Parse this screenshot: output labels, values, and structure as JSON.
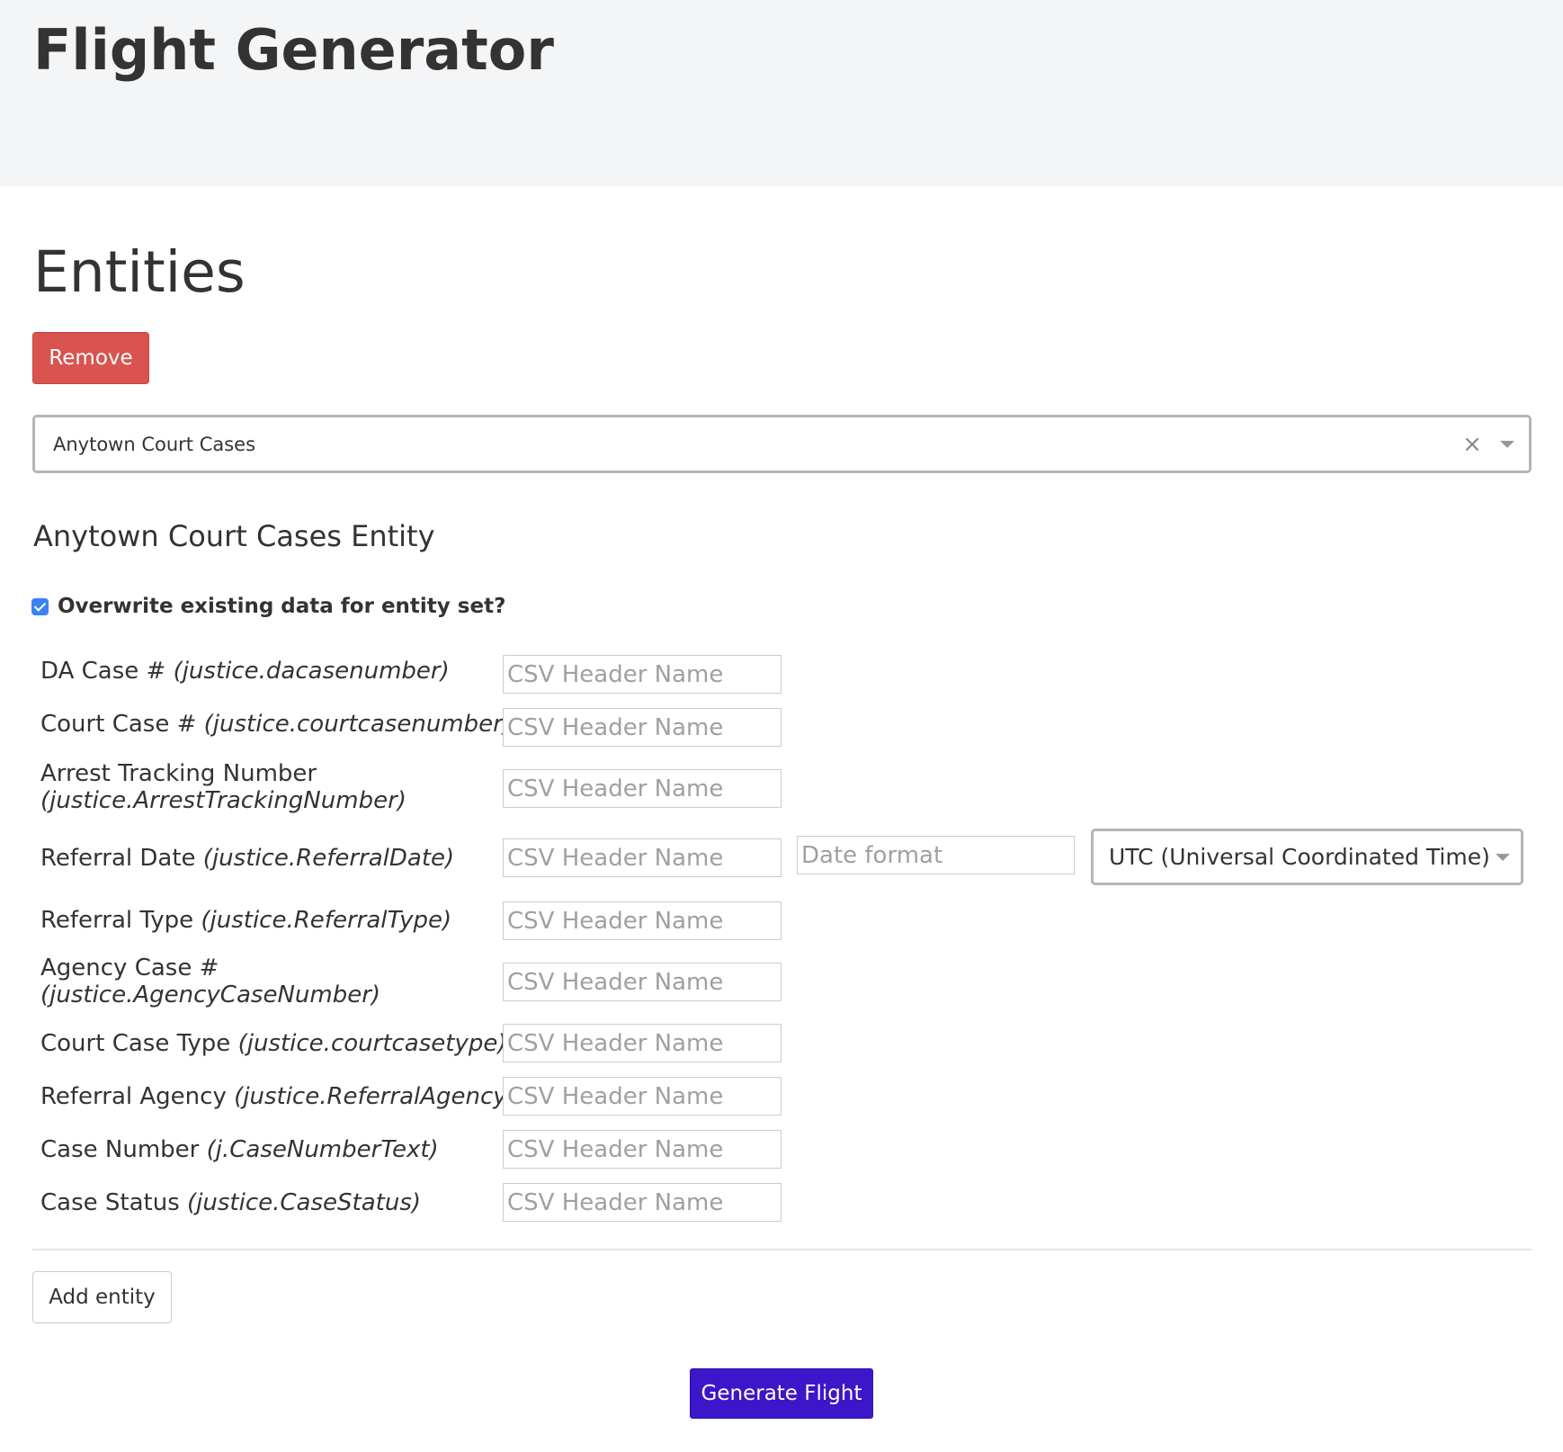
{
  "header": {
    "app_title": "Flight Generator"
  },
  "entities_section": {
    "title": "Entities",
    "remove_label": "Remove",
    "entity_select": {
      "value": "Anytown Court Cases",
      "clear_icon": "close-icon",
      "caret_icon": "chevron-down-icon"
    },
    "entity_heading": "Anytown Court Cases Entity",
    "overwrite": {
      "checked": true,
      "label": "Overwrite existing data for entity set?"
    },
    "fields": [
      {
        "name": "DA Case #",
        "property": "(justice.dacasenumber)",
        "placeholder": "CSV Header Name"
      },
      {
        "name": "Court Case #",
        "property": "(justice.courtcasenumber)",
        "placeholder": "CSV Header Name"
      },
      {
        "name": "Arrest Tracking Number",
        "property": "(justice.ArrestTrackingNumber)",
        "placeholder": "CSV Header Name"
      },
      {
        "name": "Referral Date",
        "property": "(justice.ReferralDate)",
        "placeholder": "CSV Header Name",
        "date_format_placeholder": "Date format",
        "timezone": "UTC (Universal Coordinated Time)"
      },
      {
        "name": "Referral Type",
        "property": "(justice.ReferralType)",
        "placeholder": "CSV Header Name"
      },
      {
        "name": "Agency Case #",
        "property": "(justice.AgencyCaseNumber)",
        "placeholder": "CSV Header Name"
      },
      {
        "name": "Court Case Type",
        "property": "(justice.courtcasetype)",
        "placeholder": "CSV Header Name"
      },
      {
        "name": "Referral Agency",
        "property": "(justice.ReferralAgency)",
        "placeholder": "CSV Header Name"
      },
      {
        "name": "Case Number",
        "property": "(j.CaseNumberText)",
        "placeholder": "CSV Header Name"
      },
      {
        "name": "Case Status",
        "property": "(justice.CaseStatus)",
        "placeholder": "CSV Header Name"
      }
    ],
    "add_entity_label": "Add entity"
  },
  "generate_label": "Generate Flight",
  "colors": {
    "remove": "#d9534f",
    "generate": "#3c16c9",
    "checkbox": "#3b82f6",
    "header_bg": "#f4f5f7"
  }
}
